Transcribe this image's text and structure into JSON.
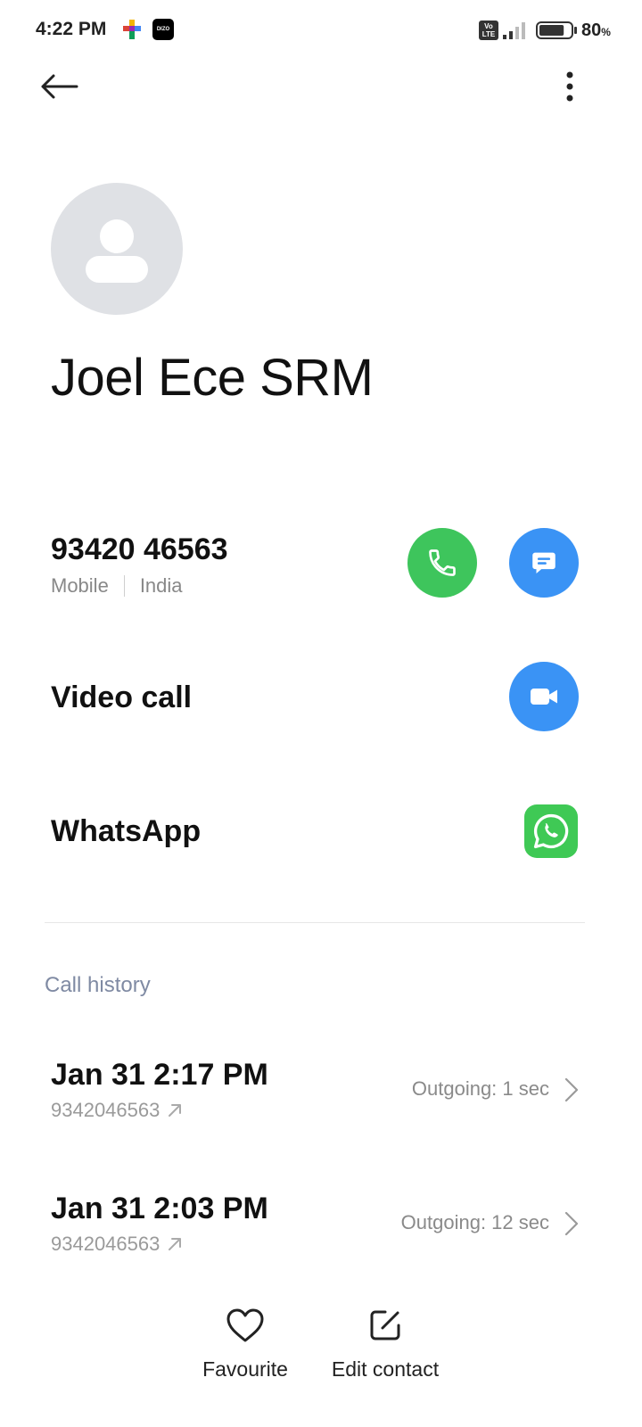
{
  "status_bar": {
    "time": "4:22 PM",
    "app_badge": "DIZO",
    "volte_top": "Vo",
    "volte_bottom": "LTE",
    "battery_level": 80,
    "battery_text": "80",
    "battery_unit": "%"
  },
  "contact": {
    "name": "Joel Ece SRM",
    "phone": "93420 46563",
    "phone_type": "Mobile",
    "phone_region": "India"
  },
  "actions": {
    "video_call_label": "Video call",
    "whatsapp_label": "WhatsApp"
  },
  "call_history": {
    "title": "Call history",
    "entries": [
      {
        "date": "Jan 31 2:17 PM",
        "number": "9342046563",
        "status": "Outgoing: 1 sec"
      },
      {
        "date": "Jan 31 2:03 PM",
        "number": "9342046563",
        "status": "Outgoing: 12 sec"
      }
    ]
  },
  "bottom_bar": {
    "favourite_label": "Favourite",
    "edit_label": "Edit contact"
  },
  "colors": {
    "call_green": "#3ec55c",
    "action_blue": "#3a93f5",
    "whatsapp_green": "#3fc955",
    "section_title": "#7f8aa3"
  }
}
